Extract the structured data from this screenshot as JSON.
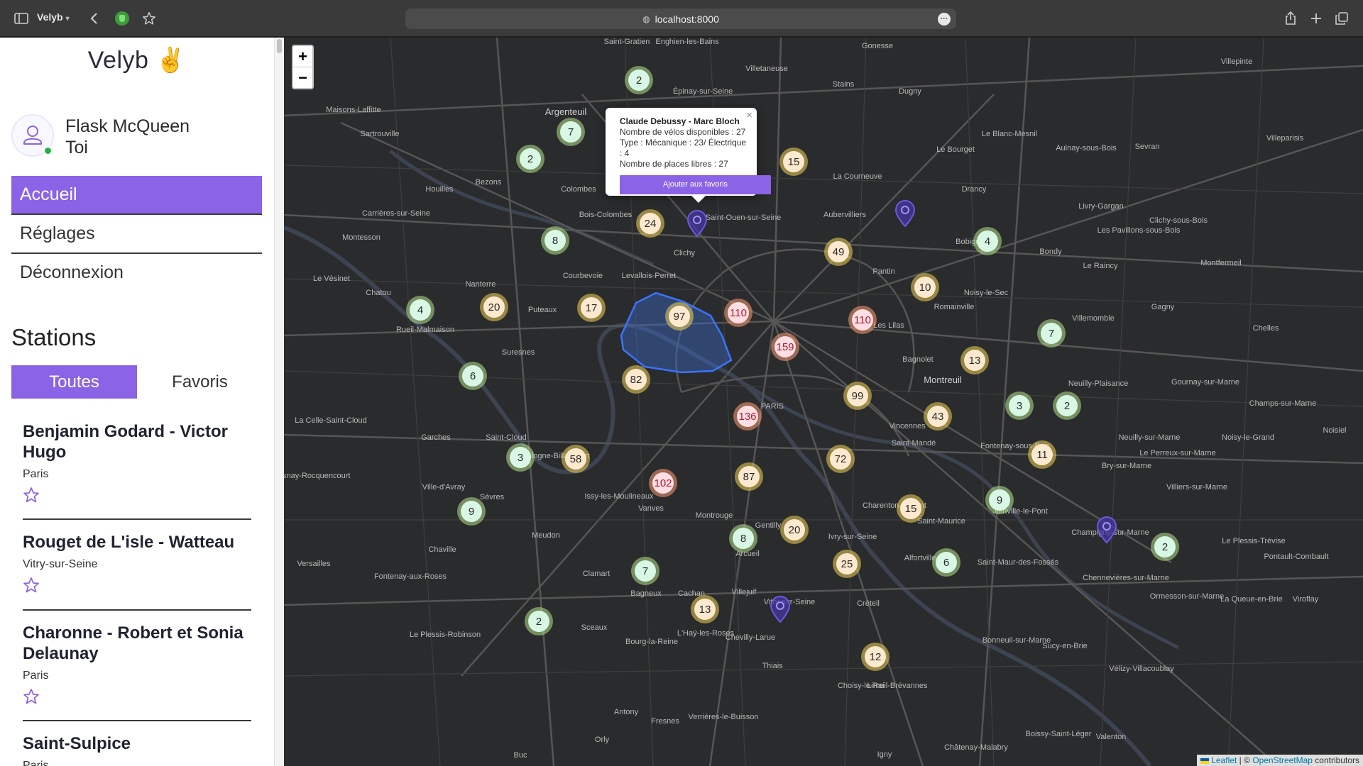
{
  "browser": {
    "profile": "Velyb",
    "url": "localhost:8000"
  },
  "app": {
    "brand": "Velyb",
    "brand_emoji": "✌",
    "user_name": "Flask McQueen",
    "user_sub": "Toi",
    "nav": [
      "Accueil",
      "Réglages",
      "Déconnexion"
    ],
    "stations_title": "Stations",
    "tabs": [
      "Toutes",
      "Favoris"
    ],
    "stations": [
      {
        "name": "Benjamin Godard - Victor Hugo",
        "city": "Paris"
      },
      {
        "name": "Rouget de L'isle - Watteau",
        "city": "Vitry-sur-Seine"
      },
      {
        "name": "Charonne - Robert et Sonia Delaunay",
        "city": "Paris"
      },
      {
        "name": "Saint-Sulpice",
        "city": "Paris"
      }
    ]
  },
  "map": {
    "zoom_in": "+",
    "zoom_out": "−",
    "popup": {
      "title": "Claude Debussy - Marc Bloch",
      "line1": "Nombre de vélos disponibles : 27",
      "line2": "Type : Mécanique : 23/ Électrique : 4",
      "line3": "Nombre de places libres : 27",
      "button": "Ajouter aux favoris",
      "close": "×"
    },
    "attribution": {
      "leaflet": "Leaflet",
      "sep": " | © ",
      "osm": "OpenStreetMap",
      "tail": " contributors"
    },
    "clusters": [
      {
        "n": "2",
        "lvl": "g"
      },
      {
        "n": "7",
        "lvl": "g"
      },
      {
        "n": "2",
        "lvl": "g"
      },
      {
        "n": "8",
        "lvl": "g"
      },
      {
        "n": "24",
        "lvl": "o"
      },
      {
        "n": "15",
        "lvl": "o"
      },
      {
        "n": "49",
        "lvl": "o"
      },
      {
        "n": "4",
        "lvl": "g"
      },
      {
        "n": "4",
        "lvl": "g"
      },
      {
        "n": "20",
        "lvl": "o"
      },
      {
        "n": "17",
        "lvl": "o"
      },
      {
        "n": "97",
        "lvl": "o"
      },
      {
        "n": "110",
        "lvl": "r"
      },
      {
        "n": "110",
        "lvl": "r"
      },
      {
        "n": "10",
        "lvl": "o"
      },
      {
        "n": "159",
        "lvl": "r"
      },
      {
        "n": "7",
        "lvl": "g"
      },
      {
        "n": "13",
        "lvl": "o"
      },
      {
        "n": "6",
        "lvl": "g"
      },
      {
        "n": "82",
        "lvl": "o"
      },
      {
        "n": "136",
        "lvl": "r"
      },
      {
        "n": "99",
        "lvl": "o"
      },
      {
        "n": "3",
        "lvl": "g"
      },
      {
        "n": "2",
        "lvl": "g"
      },
      {
        "n": "43",
        "lvl": "o"
      },
      {
        "n": "3",
        "lvl": "g"
      },
      {
        "n": "58",
        "lvl": "o"
      },
      {
        "n": "72",
        "lvl": "o"
      },
      {
        "n": "11",
        "lvl": "o"
      },
      {
        "n": "102",
        "lvl": "r"
      },
      {
        "n": "87",
        "lvl": "o"
      },
      {
        "n": "9",
        "lvl": "g"
      },
      {
        "n": "9",
        "lvl": "g"
      },
      {
        "n": "15",
        "lvl": "o"
      },
      {
        "n": "8",
        "lvl": "g"
      },
      {
        "n": "20",
        "lvl": "o"
      },
      {
        "n": "2",
        "lvl": "g"
      },
      {
        "n": "6",
        "lvl": "g"
      },
      {
        "n": "7",
        "lvl": "g"
      },
      {
        "n": "25",
        "lvl": "o"
      },
      {
        "n": "13",
        "lvl": "o"
      },
      {
        "n": "2",
        "lvl": "g"
      },
      {
        "n": "12",
        "lvl": "o"
      }
    ],
    "places": [
      "Saint-Gratien",
      "Enghien-les-Bains",
      "Villetaneuse",
      "Gonesse",
      "Villepinte",
      "Maisons-Laffitte",
      "Sartrouville",
      "Argenteuil",
      "Épinay-sur-Seine",
      "Stains",
      "Dugny",
      "Le Blanc-Mesnil",
      "Sevran",
      "Villeparisis",
      "Aulnay-sous-Bois",
      "Le Bourget",
      "La Courneuve",
      "Drancy",
      "Houilles",
      "Bezons",
      "Colombes",
      "Bois-Colombes",
      "Saint-Ouen-sur-Seine",
      "Aubervilliers",
      "Livry-Gargan",
      "Clichy-sous-Bois",
      "Carrières-sur-Seine",
      "Montesson",
      "Clichy",
      "Les Pavillons-sous-Bois",
      "Bondy",
      "Le Raincy",
      "Montfermeil",
      "Bobigny",
      "Le Vésinet",
      "Chatou",
      "Nanterre",
      "Courbevoie",
      "Levallois-Perret",
      "Pantin",
      "Noisy-le-Sec",
      "Gagny",
      "Rueil-Malmaison",
      "Puteaux",
      "Romainville",
      "Les Lilas",
      "Villemomble",
      "Chelles",
      "Suresnes",
      "Bagnolet",
      "Montreuil",
      "Neuilly-Plaisance",
      "Gournay-sur-Marne",
      "Champs-sur-Marne",
      "Noisiel",
      "La Celle-Saint-Cloud",
      "Garches",
      "Saint-Cloud",
      "Boulogne-Billancourt",
      "PARIS",
      "Vincennes",
      "Saint-Mandé",
      "Fontenay-sous-Bois",
      "Neuilly-sur-Marne",
      "Noisy-le-Grand",
      "Le Perreux-sur-Marne",
      "Bry-sur-Marne",
      "Le Chesnay-Rocquencourt",
      "Ville-d'Avray",
      "Sèvres",
      "Issy-les-Moulineaux",
      "Vanves",
      "Montrouge",
      "Gentilly",
      "Ivry-sur-Seine",
      "Charenton-le-Pont",
      "Saint-Maurice",
      "Joinville-le-Pont",
      "Champigny-sur-Marne",
      "Villiers-sur-Marne",
      "Le Plessis-Trévise",
      "Pontault-Combault",
      "Versailles",
      "Chaville",
      "Meudon",
      "Clamart",
      "Arcueil",
      "Alfortville",
      "Saint-Maur-des-Fossés",
      "Chennevières-sur-Marne",
      "Ormesson-sur-Marne",
      "La Queue-en-Brie",
      "Viroflay",
      "Fontenay-aux-Roses",
      "Bagneux",
      "Cachan",
      "Villejuif",
      "Vitry-sur-Seine",
      "Créteil",
      "Bonneuil-sur-Marne",
      "Sucy-en-Brie",
      "Vélizy-Villacoublay",
      "Le Plessis-Robinson",
      "Sceaux",
      "Bourg-la-Reine",
      "L'Haÿ-les-Roses",
      "Chevilly-Larue",
      "Thiais",
      "Choisy-le-Roi",
      "Limeil-Brévannes",
      "Boissy-Saint-Léger",
      "Valenton",
      "Châtenay-Malabry",
      "Antony",
      "Fresnes",
      "Verrières-le-Buisson",
      "Orly",
      "Igny",
      "Buc"
    ]
  }
}
